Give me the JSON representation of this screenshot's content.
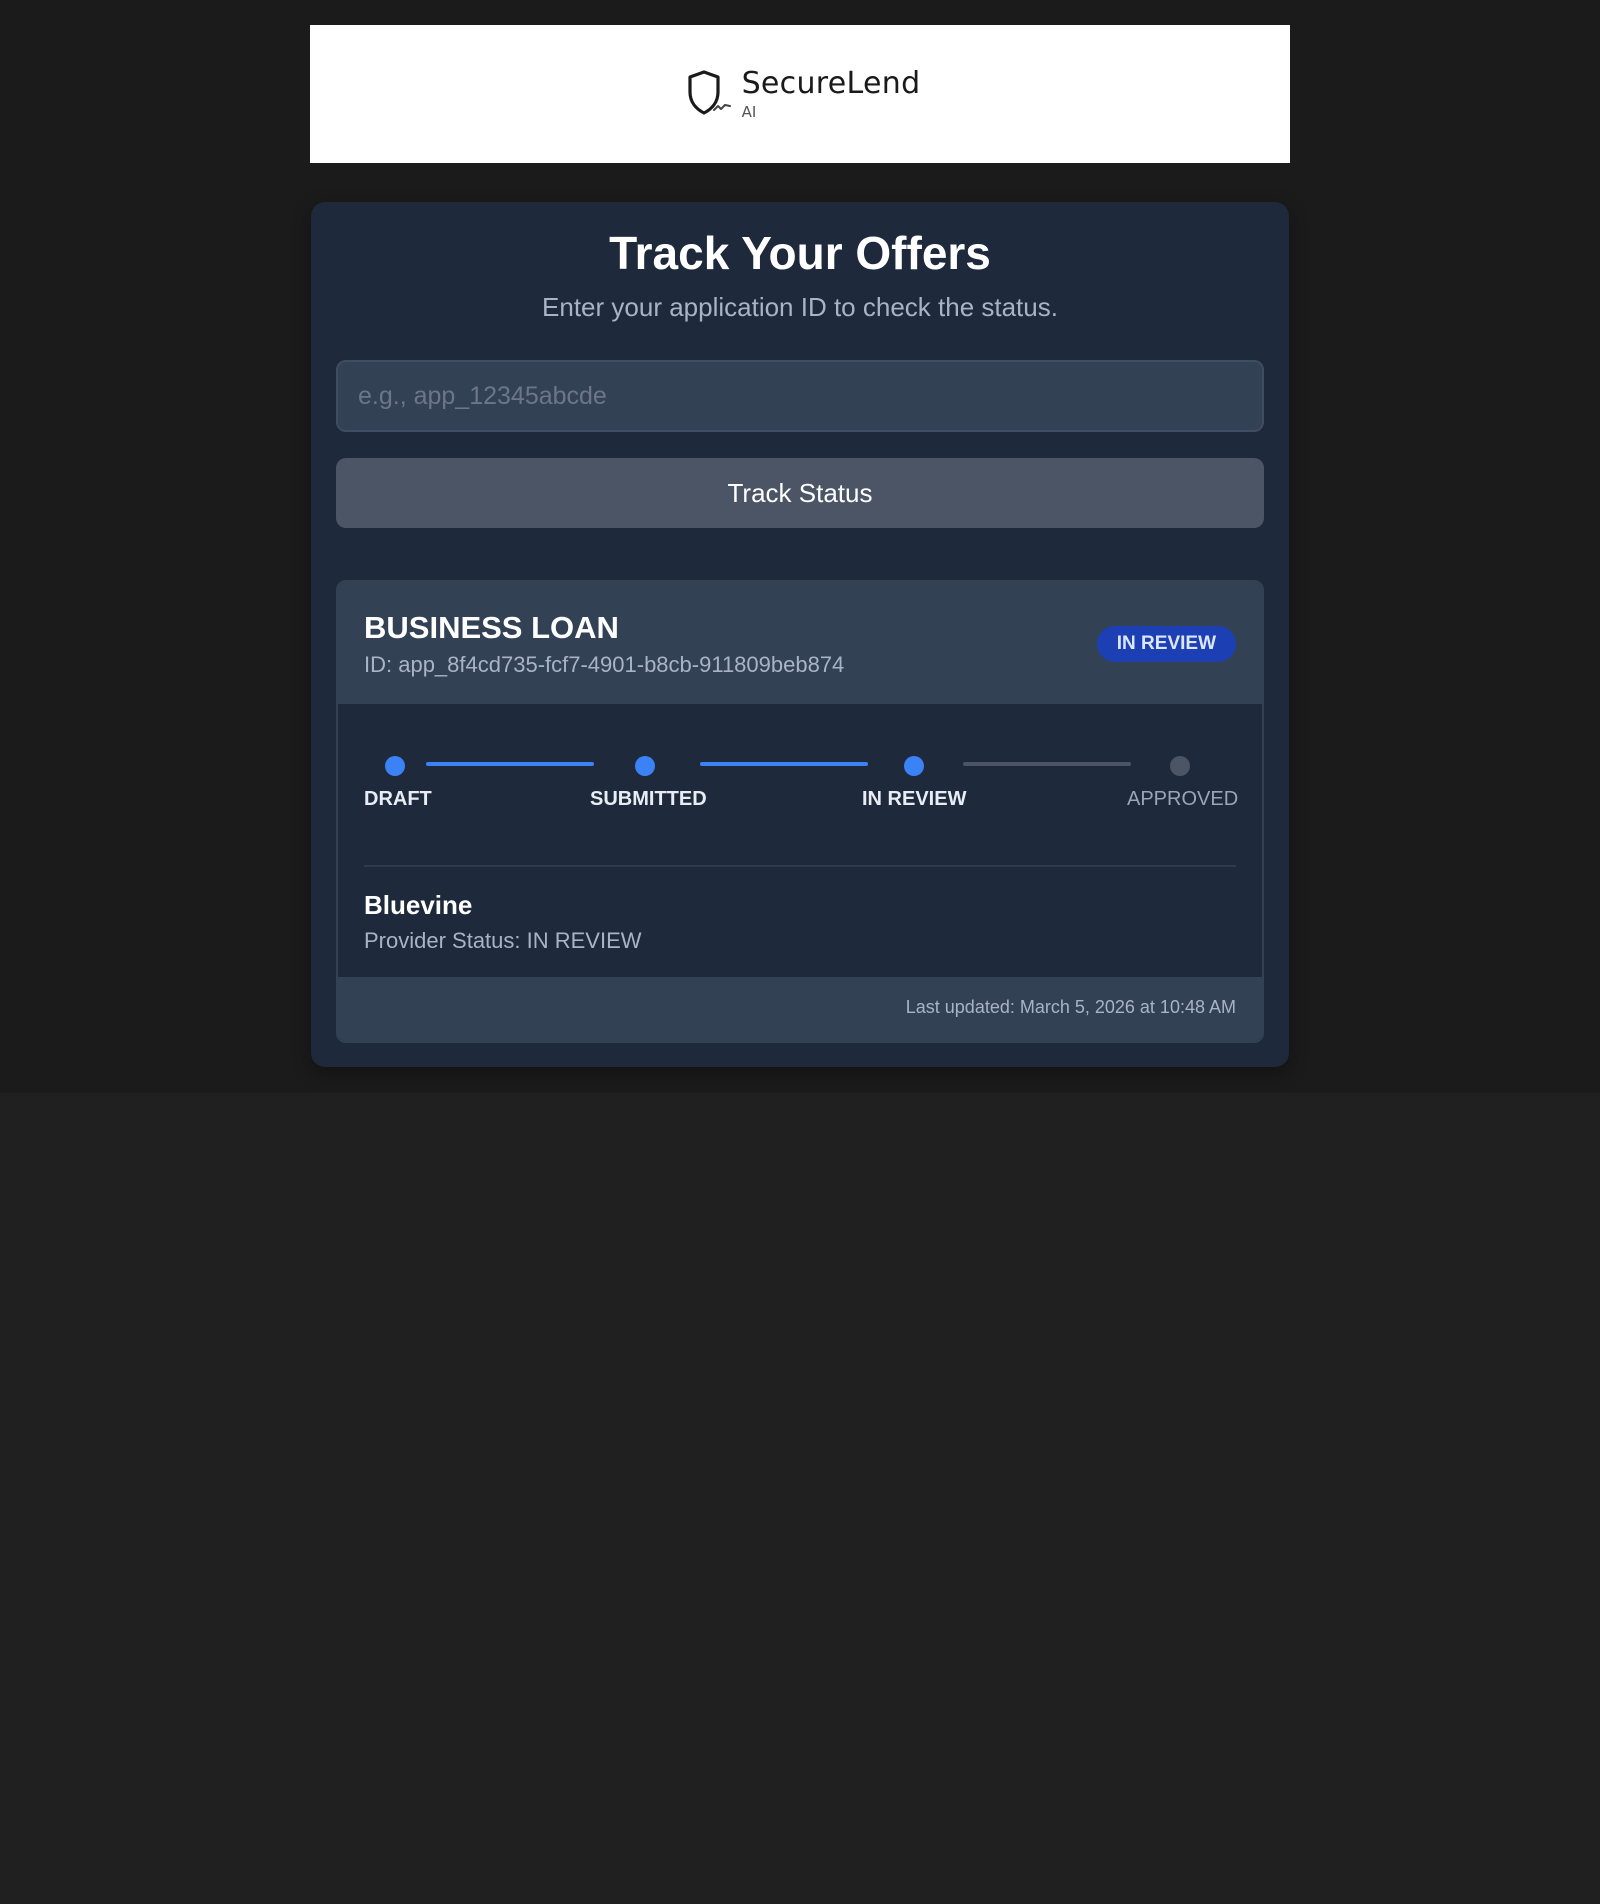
{
  "header": {
    "logo_icon": "shield-icon",
    "brand_name": "SecureLend",
    "brand_sub": "AI"
  },
  "page": {
    "title": "Track Your Offers",
    "subtitle": "Enter your application ID to check the status."
  },
  "search": {
    "placeholder": "e.g., app_12345abcde",
    "value": "",
    "button_label": "Track Status"
  },
  "application": {
    "type": "BUSINESS LOAN",
    "id_text": "ID: app_8f4cd735-fcf7-4901-b8cb-911809beb874",
    "status_badge": "IN REVIEW",
    "steps": [
      {
        "label": "DRAFT",
        "state": "done"
      },
      {
        "label": "SUBMITTED",
        "state": "done"
      },
      {
        "label": "IN REVIEW",
        "state": "done"
      },
      {
        "label": "APPROVED",
        "state": "pending"
      }
    ],
    "provider": {
      "name": "Bluevine",
      "status_text": "Provider Status: IN REVIEW"
    },
    "last_updated": "Last updated: March 5, 2026 at 10:48 AM"
  },
  "colors": {
    "accent": "#3b82f6",
    "badge_bg": "#1d3fb4",
    "card_bg": "#1e293b",
    "pending": "#4b5565"
  }
}
